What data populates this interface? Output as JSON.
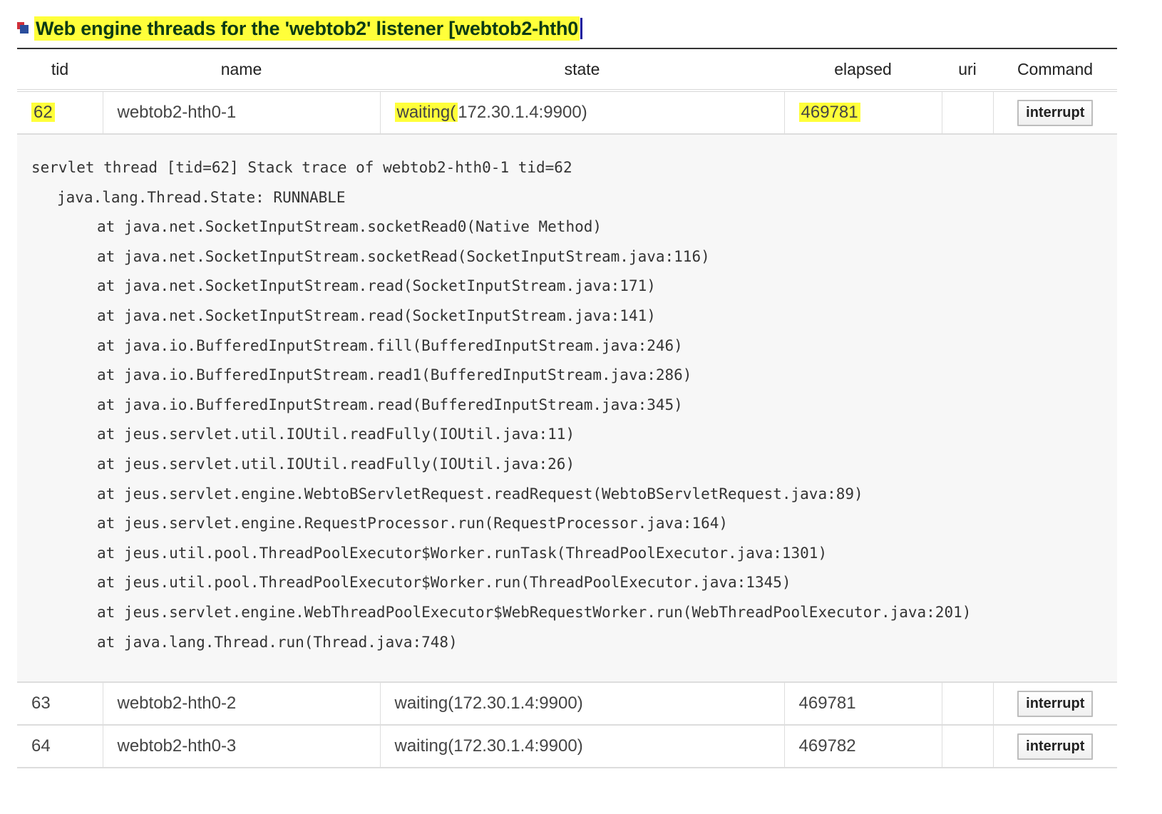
{
  "header": {
    "title": "Web engine threads for the 'webtob2' listener [webtob2-hth0"
  },
  "table": {
    "columns": [
      "tid",
      "name",
      "state",
      "elapsed",
      "uri",
      "Command"
    ],
    "rows": [
      {
        "tid": "62",
        "name": "webtob2-hth0-1",
        "state_part1": "waiting(",
        "state_part2": "172.30.1.4:9900)",
        "elapsed": "469781",
        "uri": "",
        "command": "interrupt"
      },
      {
        "tid": "63",
        "name": "webtob2-hth0-2",
        "state": "waiting(172.30.1.4:9900)",
        "elapsed": "469781",
        "uri": "",
        "command": "interrupt"
      },
      {
        "tid": "64",
        "name": "webtob2-hth0-3",
        "state": "waiting(172.30.1.4:9900)",
        "elapsed": "469782",
        "uri": "",
        "command": "interrupt"
      }
    ]
  },
  "stack_trace": {
    "header": "servlet thread [tid=62] Stack trace of webtob2-hth0-1 tid=62",
    "state": "java.lang.Thread.State: RUNNABLE",
    "frames": [
      "at java.net.SocketInputStream.socketRead0(Native Method)",
      "at java.net.SocketInputStream.socketRead(SocketInputStream.java:116)",
      "at java.net.SocketInputStream.read(SocketInputStream.java:171)",
      "at java.net.SocketInputStream.read(SocketInputStream.java:141)",
      "at java.io.BufferedInputStream.fill(BufferedInputStream.java:246)",
      "at java.io.BufferedInputStream.read1(BufferedInputStream.java:286)",
      "at java.io.BufferedInputStream.read(BufferedInputStream.java:345)",
      "at jeus.servlet.util.IOUtil.readFully(IOUtil.java:11)",
      "at jeus.servlet.util.IOUtil.readFully(IOUtil.java:26)",
      "at jeus.servlet.engine.WebtoBServletRequest.readRequest(WebtoBServletRequest.java:89)",
      "at jeus.servlet.engine.RequestProcessor.run(RequestProcessor.java:164)",
      "at jeus.util.pool.ThreadPoolExecutor$Worker.runTask(ThreadPoolExecutor.java:1301)",
      "at jeus.util.pool.ThreadPoolExecutor$Worker.run(ThreadPoolExecutor.java:1345)",
      "at jeus.servlet.engine.WebThreadPoolExecutor$WebRequestWorker.run(WebThreadPoolExecutor.java:201)",
      "at java.lang.Thread.run(Thread.java:748)"
    ]
  },
  "colors": {
    "highlight": "#ffff3a",
    "title_text": "#0a3a14",
    "trace_background": "#f7f7f7"
  }
}
